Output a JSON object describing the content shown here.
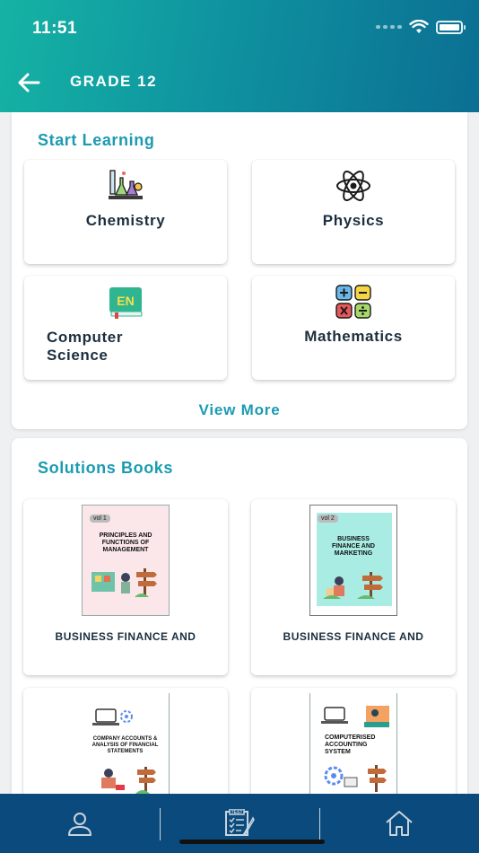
{
  "status_bar": {
    "time": "11:51"
  },
  "header": {
    "title": "GRADE 12"
  },
  "start_learning": {
    "title": "Start Learning",
    "subjects": [
      {
        "label": "Chemistry",
        "icon": "chemistry-flask-icon"
      },
      {
        "label": "Physics",
        "icon": "atom-icon"
      },
      {
        "label": "Computer\nScience",
        "icon": "en-book-icon"
      },
      {
        "label": "Mathematics",
        "icon": "calculator-symbols-icon"
      }
    ],
    "view_more": "View More"
  },
  "solutions_books": {
    "title": "Solutions Books",
    "books": [
      {
        "label": "BUSINESS FINANCE AND",
        "vol": "vol 1",
        "cover_title": "PRINCIPLES AND FUNCTIONS OF MANAGEMENT",
        "cover_color": "#fbe7ea"
      },
      {
        "label": "BUSINESS FINANCE AND",
        "vol": "vol 2",
        "cover_title": "BUSINESS FINANCE AND MARKETING",
        "cover_color": "#a8ece4"
      },
      {
        "label": "",
        "vol": "",
        "cover_title": "COMPANY ACCOUNTS & ANALYSIS OF FINANCIAL STATEMENTS",
        "cover_color": "#ffffff"
      },
      {
        "label": "",
        "vol": "",
        "cover_title": "COMPUTERISED ACCOUNTING SYSTEM",
        "cover_color": "#ffffff"
      }
    ]
  },
  "bottom_nav": [
    {
      "icon": "profile-icon"
    },
    {
      "icon": "test-icon"
    },
    {
      "icon": "home-icon"
    }
  ],
  "colors": {
    "accent": "#1b9bb1",
    "nav": "#0b4a7d",
    "header_start": "#15b3a4",
    "header_end": "#0b6f93"
  }
}
